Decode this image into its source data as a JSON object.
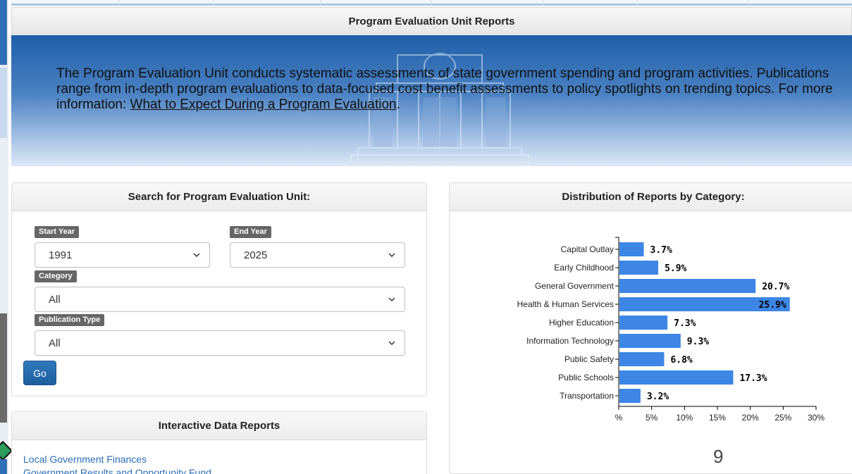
{
  "page": {
    "title": "Program Evaluation Unit Reports",
    "intro_text": "The Program Evaluation Unit conducts systematic assessments of state government spending and program activities. Publications range from in-depth program evaluations to data-focused cost benefit assessments to policy spotlights on trending topics. For more information: ",
    "intro_link": "What to Expect During a Program Evaluation",
    "intro_end": ".",
    "page_number": "9"
  },
  "search": {
    "title": "Search for Program Evaluation Unit:",
    "start_year_label": "Start Year",
    "start_year_value": "1991",
    "end_year_label": "End Year",
    "end_year_value": "2025",
    "category_label": "Category",
    "category_value": "All",
    "pub_type_label": "Publication Type",
    "pub_type_value": "All",
    "go_label": "Go"
  },
  "interactive": {
    "title": "Interactive Data Reports",
    "links": [
      "Local Government Finances",
      "Government Results and Opportunity Fund"
    ]
  },
  "chart_panel": {
    "title": "Distribution of Reports by Category:"
  },
  "chart_data": {
    "type": "bar",
    "orientation": "horizontal",
    "categories": [
      "Capital Outlay",
      "Early Childhood",
      "General Government",
      "Health & Human Services",
      "Higher Education",
      "Information Technology",
      "Public Safety",
      "Public Schools",
      "Transportation"
    ],
    "values": [
      3.7,
      5.9,
      20.7,
      25.9,
      7.3,
      9.3,
      6.8,
      17.3,
      3.2
    ],
    "labels": [
      "3.7%",
      "5.9%",
      "20.7%",
      "25.9%",
      "7.3%",
      "9.3%",
      "6.8%",
      "17.3%",
      "3.2%"
    ],
    "xlim": [
      0,
      30
    ],
    "xticks": [
      0,
      5,
      10,
      15,
      20,
      25,
      30
    ],
    "xtick_labels": [
      "%",
      "5%",
      "10%",
      "15%",
      "20%",
      "25%",
      "30%"
    ],
    "bar_color": "#3d86e6",
    "grid": false
  },
  "colors": {
    "accent": "#1f5fa9",
    "link": "#2a6db5",
    "tag": "#666666"
  }
}
